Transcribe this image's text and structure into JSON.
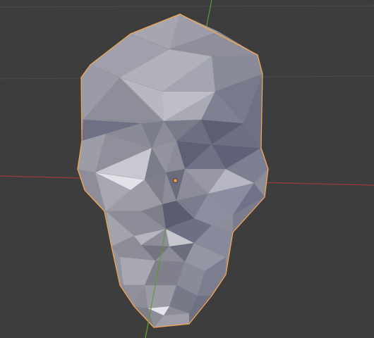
{
  "viewport": {
    "background": "#3d3d3d",
    "grid_color": "#4a4a4a",
    "x_axis_color": "#9a3a3a",
    "y_axis_color": "#5e9a2e"
  },
  "scene": {
    "object": {
      "name": "low-poly-skull-mesh",
      "selected": true,
      "selection_outline_color": "#f2a653",
      "origin_color": "#f2a653"
    }
  }
}
